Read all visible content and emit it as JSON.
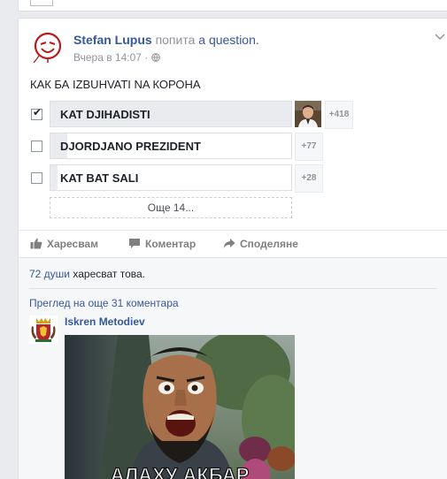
{
  "post": {
    "author": "Stefan Lupus",
    "verb": "попита",
    "object": "a question.",
    "time": "Вчера в 14:07",
    "time_separator": "·",
    "question": "КАК БА IZBUHVATI NA КОРОНА",
    "options": [
      {
        "label": "KAT DJIHADISTI",
        "count": "+418",
        "checked": true,
        "share": 1.0
      },
      {
        "label": "DJORDJANO PREZIDENT",
        "count": "+77",
        "checked": false,
        "share": 0.07
      },
      {
        "label": "KAT BAT SALI",
        "count": "+28",
        "checked": false,
        "share": 0.03
      }
    ],
    "more_options": "Още 14..."
  },
  "actions": {
    "like": "Харесвам",
    "comment": "Коментар",
    "share": "Споделяне"
  },
  "likes_line": {
    "count": "72 души",
    "rest": "харесват това."
  },
  "view_more_comments": "Преглед на още 31 коментара",
  "comment": {
    "author": "Iskren Metodiev",
    "photo_caption": "АЛАХУ АКБАР"
  },
  "colors": {
    "link": "#365899",
    "muted": "#90949c",
    "background": "#e9ebee",
    "poll_fill": "#e9ebee"
  },
  "icons": {
    "menu": "chevron-down-icon",
    "audience": "globe-icon",
    "like": "thumbs-up-icon",
    "comment": "speech-bubble-icon",
    "share": "share-arrow-icon"
  }
}
